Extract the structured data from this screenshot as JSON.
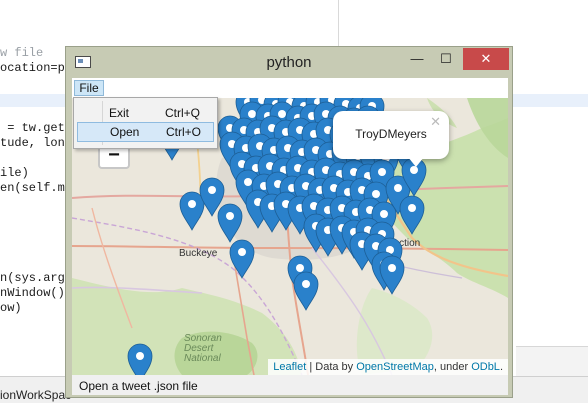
{
  "editor": {
    "lines": [
      {
        "text": "w file",
        "comment": true
      },
      {
        "text": "ocation=ph",
        "comment": false
      },
      {
        "text": " = tw.getR",
        "comment": false
      },
      {
        "text": "tude, long",
        "comment": false
      },
      {
        "text": "ile)",
        "comment": false
      },
      {
        "text": "en(self.ma",
        "comment": false
      },
      {
        "text": "n(sys.argv",
        "comment": false
      },
      {
        "text": "nWindow()",
        "comment": false
      },
      {
        "text": "ow)",
        "comment": false
      }
    ],
    "bottom_label": "ionWorkSpac"
  },
  "window": {
    "title": "python",
    "minimize_glyph": "—",
    "maximize_glyph": "☐",
    "close_glyph": "✕"
  },
  "menubar": {
    "file_label": "File"
  },
  "file_menu": {
    "items": [
      {
        "label": "Exit",
        "shortcut": "Ctrl+Q"
      },
      {
        "label": "Open",
        "shortcut": "Ctrl+O"
      }
    ]
  },
  "map": {
    "zoom_out_label": "−",
    "place_labels": [
      "Buckeye",
      "unction",
      "Sonoran",
      "Desert",
      "National"
    ],
    "popup": {
      "text": "TroyDMeyers",
      "close_glyph": "✕"
    },
    "attribution": {
      "leaflet": "Leaflet",
      "data_by": " | Data by ",
      "osm": "OpenStreetMap",
      "under": ", under ",
      "license": "ODbL",
      "end": "."
    },
    "marker_color": "#2a81cb"
  },
  "statusbar": {
    "text": "Open a tweet .json file"
  }
}
